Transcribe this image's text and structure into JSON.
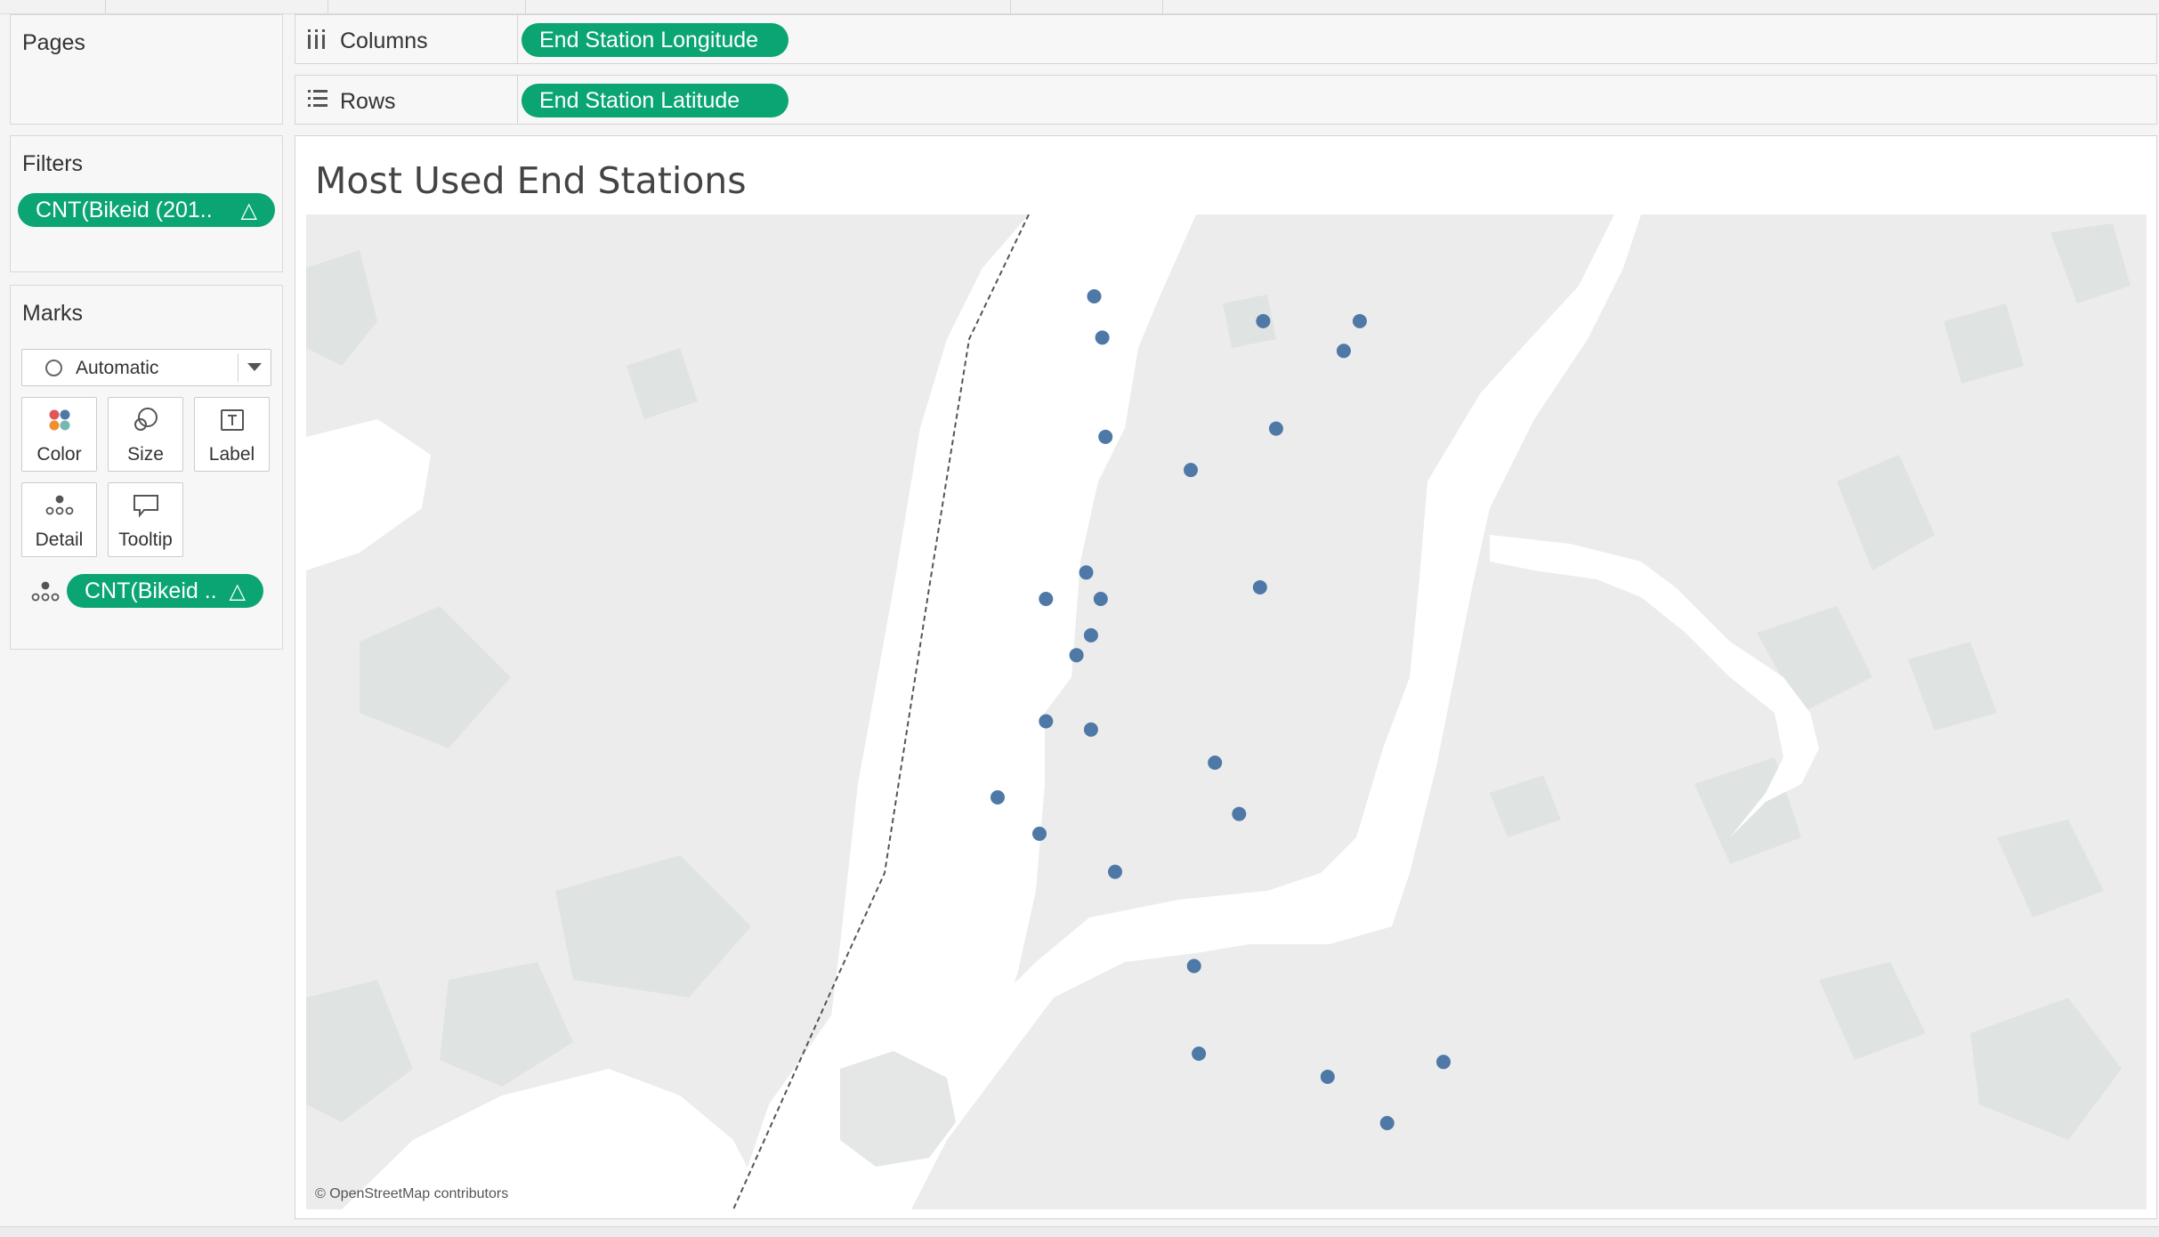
{
  "left_panel": {
    "pages": {
      "title": "Pages"
    },
    "filters": {
      "title": "Filters",
      "pill": "CNT(Bikeid (201..",
      "pill_icon": "delta-icon"
    },
    "marks": {
      "title": "Marks",
      "type_select": "Automatic",
      "buttons": [
        {
          "label": "Color",
          "icon": "color-icon"
        },
        {
          "label": "Size",
          "icon": "size-icon"
        },
        {
          "label": "Label",
          "icon": "label-icon"
        },
        {
          "label": "Detail",
          "icon": "detail-icon"
        },
        {
          "label": "Tooltip",
          "icon": "tooltip-icon"
        }
      ],
      "detail_pill": "CNT(Bikeid ..",
      "detail_pill_icon": "delta-icon"
    }
  },
  "shelves": {
    "columns": {
      "label": "Columns",
      "pill": "End Station Longitude"
    },
    "rows": {
      "label": "Rows",
      "pill": "End Station Latitude"
    }
  },
  "viz": {
    "title": "Most Used End Stations",
    "attribution": "© OpenStreetMap contributors",
    "mark_color": "#4e79a7",
    "accent": "#0ba574"
  },
  "chart_data": {
    "type": "scatter",
    "title": "Most Used End Stations",
    "xlabel": "End Station Longitude",
    "ylabel": "End Station Latitude",
    "description_of_points": "End station locations plotted on map",
    "points": [
      {
        "x": -74.0045,
        "y": 40.7645
      },
      {
        "x": -74.004,
        "y": 40.762
      },
      {
        "x": -73.994,
        "y": 40.763
      },
      {
        "x": -73.988,
        "y": 40.763
      },
      {
        "x": -73.989,
        "y": 40.7612
      },
      {
        "x": -74.0038,
        "y": 40.756
      },
      {
        "x": -73.9985,
        "y": 40.754
      },
      {
        "x": -73.9932,
        "y": 40.7565
      },
      {
        "x": -74.005,
        "y": 40.7478
      },
      {
        "x": -74.0075,
        "y": 40.7462
      },
      {
        "x": -74.0041,
        "y": 40.7462
      },
      {
        "x": -73.9942,
        "y": 40.7469
      },
      {
        "x": -74.0047,
        "y": 40.744
      },
      {
        "x": -74.0056,
        "y": 40.7428
      },
      {
        "x": -74.0075,
        "y": 40.7388
      },
      {
        "x": -74.0047,
        "y": 40.7383
      },
      {
        "x": -73.997,
        "y": 40.7363
      },
      {
        "x": -73.9955,
        "y": 40.7332
      },
      {
        "x": -74.0105,
        "y": 40.7342
      },
      {
        "x": -74.0079,
        "y": 40.732
      },
      {
        "x": -74.0032,
        "y": 40.7297
      },
      {
        "x": -73.9983,
        "y": 40.724
      },
      {
        "x": -73.998,
        "y": 40.7187
      },
      {
        "x": -73.99,
        "y": 40.7173
      },
      {
        "x": -73.9828,
        "y": 40.7182
      },
      {
        "x": -73.9863,
        "y": 40.7145
      }
    ]
  }
}
